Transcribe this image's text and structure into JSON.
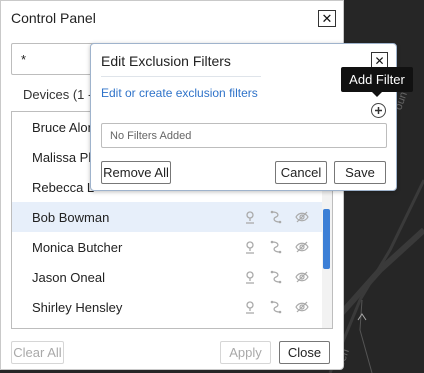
{
  "control_panel": {
    "title": "Control Panel",
    "close_glyph": "✕",
    "search_value": "*",
    "devices_label": "Devices (1 -",
    "devices": [
      {
        "name": "Bruce Alon",
        "selected": false
      },
      {
        "name": "Malissa Ph",
        "selected": false
      },
      {
        "name": "Rebecca L",
        "selected": false
      },
      {
        "name": "Bob Bowman",
        "selected": true
      },
      {
        "name": "Monica Butcher",
        "selected": false
      },
      {
        "name": "Jason Oneal",
        "selected": false
      },
      {
        "name": "Shirley Hensley",
        "selected": false
      }
    ],
    "row_icons": [
      "location-pin-icon",
      "route-icon",
      "hide-icon"
    ],
    "buttons": {
      "clear_all": "Clear All",
      "apply": "Apply",
      "close": "Close"
    }
  },
  "exclusion_dialog": {
    "title": "Edit Exclusion Filters",
    "close_glyph": "✕",
    "link": "Edit or create exclusion filters",
    "empty_text": "No Filters Added",
    "buttons": {
      "remove_all": "Remove All",
      "cancel": "Cancel",
      "save": "Save"
    },
    "tooltip": "Add Filter"
  },
  "map": {
    "labels": [
      "oun",
      "een"
    ]
  },
  "colors": {
    "accent": "#3c7fd6",
    "link": "#2f73c9",
    "selected_row": "#e7effa",
    "map_bg": "#262626"
  }
}
